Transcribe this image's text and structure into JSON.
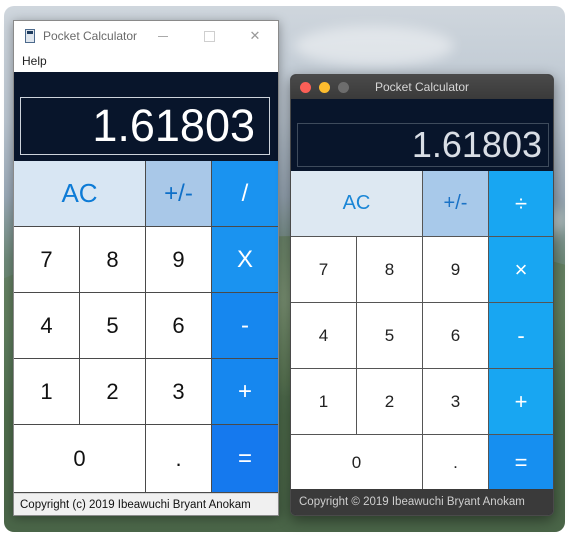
{
  "windows_app": {
    "title": "Pocket Calculator",
    "menu": [
      "Help"
    ],
    "display": "1.61803",
    "keys": [
      "AC",
      "+/-",
      "/",
      "7",
      "8",
      "9",
      "X",
      "4",
      "5",
      "6",
      "-",
      "1",
      "2",
      "3",
      "+",
      "0",
      ".",
      "="
    ],
    "status": "Copyright (c) 2019 Ibeawuchi Bryant Anokam",
    "controls": {
      "close": "✕"
    }
  },
  "mac_app": {
    "title": "Pocket Calculator",
    "display": "1.61803",
    "keys": [
      "AC",
      "+/-",
      "÷",
      "7",
      "8",
      "9",
      "×",
      "4",
      "5",
      "6",
      "-",
      "1",
      "2",
      "3",
      "+",
      "0",
      ".",
      "="
    ],
    "status": "Copyright © 2019 Ibeawuchi Bryant Anokam"
  },
  "colors": {
    "display_bg": "#08152b",
    "ac_key": "#d8e6f3",
    "sign_key": "#a9c8e8",
    "operator_key": "#1a93f0",
    "traffic_red": "#fc5f57",
    "traffic_yellow": "#fdbc2e"
  }
}
